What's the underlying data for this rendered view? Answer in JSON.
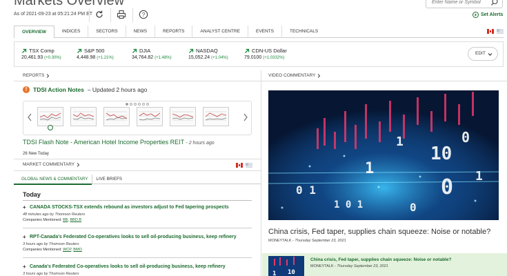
{
  "header": {
    "title": "Markets Overview",
    "as_of": "As of 2021-09-23 at 05:21:24 PM ET",
    "search_placeholder": "Enter Name or Symbol",
    "set_alerts": "Set Alerts"
  },
  "tabs": [
    {
      "label": "OVERVIEW",
      "active": true
    },
    {
      "label": "INDICES"
    },
    {
      "label": "SECTORS"
    },
    {
      "label": "NEWS"
    },
    {
      "label": "REPORTS"
    },
    {
      "label": "ANALYST CENTRE"
    },
    {
      "label": "EVENTS"
    },
    {
      "label": "TECHNICALS"
    }
  ],
  "tickers": [
    {
      "name": "TSX Comp",
      "value": "20,461.93",
      "change": "(+0.30%)"
    },
    {
      "name": "S&P 500",
      "value": "4,448.98",
      "change": "(+1.21%)"
    },
    {
      "name": "DJIA",
      "value": "34,764.82",
      "change": "(+1.48%)"
    },
    {
      "name": "NASDAQ",
      "value": "15,052.24",
      "change": "(+1.04%)"
    },
    {
      "name": "CDN-US Dollar",
      "value": "79.0100",
      "change": "(+1.0332%)"
    }
  ],
  "edit_label": "EDIT",
  "reports": {
    "section_label": "REPORTS",
    "notes_title": "TDSI Action Notes",
    "notes_updated": "– Updated 2 hours ago",
    "flash_note": "TDSI Flash Note - American Hotel Income Properties REIT",
    "flash_ago": "- 2 hours ago",
    "new_today": "26 New Today"
  },
  "market_commentary": {
    "section_label": "MARKET COMMENTARY",
    "subtabs": [
      "GLOBAL NEWS & COMMENTARY",
      "LIVE BRIEFS"
    ],
    "today": "Today",
    "news": [
      {
        "title": "CANADA STOCKS-TSX extends rebound as investors adjust to Fed tapering prospects",
        "meta": "48 minutes ago by Thomson Reuters",
        "companies_label": "Companies Mentioned:",
        "companies": [
          "BB",
          "BBD.B"
        ]
      },
      {
        "title": "RPT-Canada's Federated Co-operatives looks to sell oil-producing business, keep refinery",
        "meta": "3 hours ago by Thomson Reuters",
        "companies_label": "Companies Mentioned:",
        "companies": [
          "WCP",
          "BMO"
        ]
      },
      {
        "title": "Canada's Federated Co-operatives looks to sell oil-producing business, keep refinery",
        "meta": "3 hours ago by Thomson Reuters",
        "companies_label": "",
        "companies": []
      }
    ]
  },
  "video": {
    "section_label": "VIDEO COMMENTARY",
    "title": "China crisis, Fed taper, supplies chain squeeze: Noise or notable?",
    "source": "MONEYTALK",
    "date": "- Thursday September 23, 2021",
    "row_title": "China crisis, Fed taper, supplies chain squeeze: Noise or notable?",
    "row_source": "MONEYTALK",
    "row_date": "- Thursday September 23, 2021"
  }
}
